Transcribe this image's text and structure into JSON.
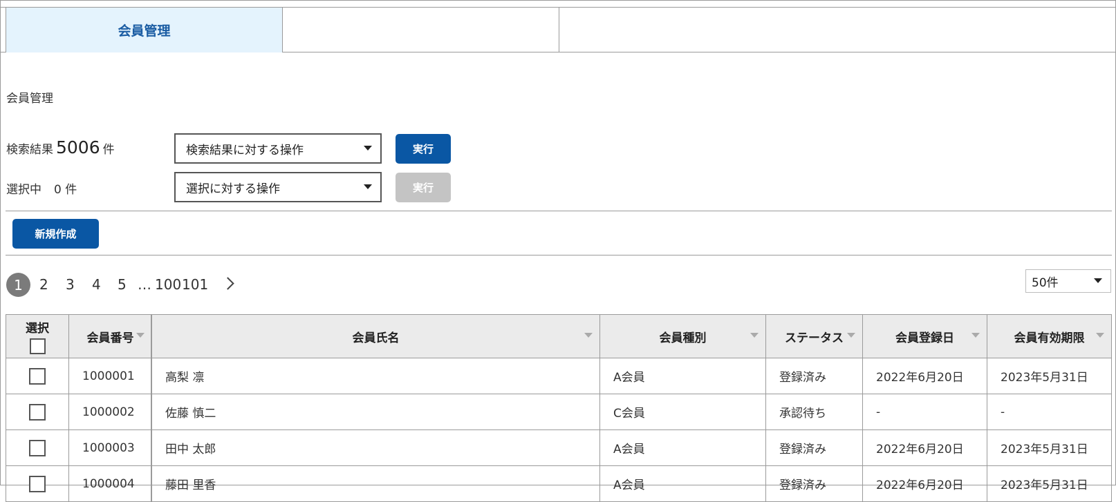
{
  "tabs": [
    {
      "label": "会員管理"
    },
    {
      "label": ""
    },
    {
      "label": ""
    }
  ],
  "page_title": "会員管理",
  "search_result": {
    "label": "検索結果",
    "count": "5006",
    "unit": "件"
  },
  "selected": {
    "label": "選択中",
    "count": "0 件"
  },
  "search_action": {
    "value": "検索結果に対する操作"
  },
  "selection_action": {
    "value": "選択に対する操作"
  },
  "buttons": {
    "execute": "実行",
    "execute_disabled": "実行",
    "create": "新規作成"
  },
  "pagination": {
    "current": "1",
    "pages": [
      "2",
      "3",
      "4",
      "5"
    ],
    "ellipsis": "…",
    "tail": [
      "100",
      "101"
    ]
  },
  "per_page": {
    "value": "50件"
  },
  "table": {
    "headers": {
      "select": "選択",
      "member_no": "会員番号",
      "name": "会員氏名",
      "type": "会員種別",
      "status": "ステータス",
      "registered": "会員登録日",
      "expiry": "会員有効期限"
    },
    "rows": [
      {
        "member_no": "1000001",
        "name": "高梨 凛",
        "type": "A会員",
        "status": "登録済み",
        "registered": "2022年6月20日",
        "expiry": "2023年5月31日"
      },
      {
        "member_no": "1000002",
        "name": "佐藤 慎二",
        "type": "C会員",
        "status": "承認待ち",
        "registered": "-",
        "expiry": "-"
      },
      {
        "member_no": "1000003",
        "name": "田中 太郎",
        "type": "A会員",
        "status": "登録済み",
        "registered": "2022年6月20日",
        "expiry": "2023年5月31日"
      },
      {
        "member_no": "1000004",
        "name": "藤田 里香",
        "type": "A会員",
        "status": "登録済み",
        "registered": "2022年6月20日",
        "expiry": "2023年5月31日"
      }
    ]
  },
  "colors": {
    "primary": "#0a57a4",
    "tab_active_bg": "#e4f3fd",
    "disabled": "#c4c4c4",
    "header_bg": "#ebebeb"
  }
}
